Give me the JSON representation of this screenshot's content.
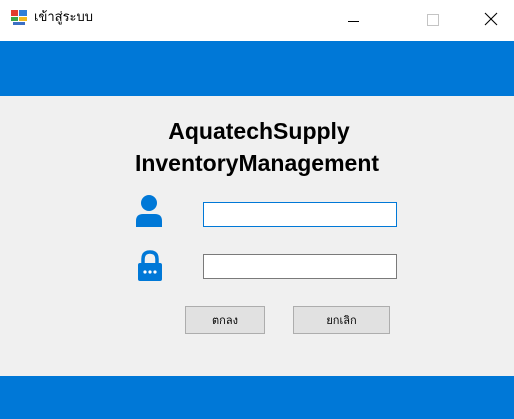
{
  "window": {
    "title": "เข้าสู่ระบบ",
    "accent_color": "#0078d7",
    "controls": {
      "minimize_icon": "minimize-icon",
      "maximize_icon": "maximize-icon",
      "close_icon": "close-icon",
      "close_glyph": "✕"
    }
  },
  "header": {
    "line1": "AquatechSupply",
    "line2": "InventoryManagement"
  },
  "form": {
    "username_icon": "user-icon",
    "username_value": "",
    "password_icon": "lock-icon",
    "password_value": ""
  },
  "buttons": {
    "ok_label": "ตกลง",
    "cancel_label": "ยกเลิก"
  }
}
